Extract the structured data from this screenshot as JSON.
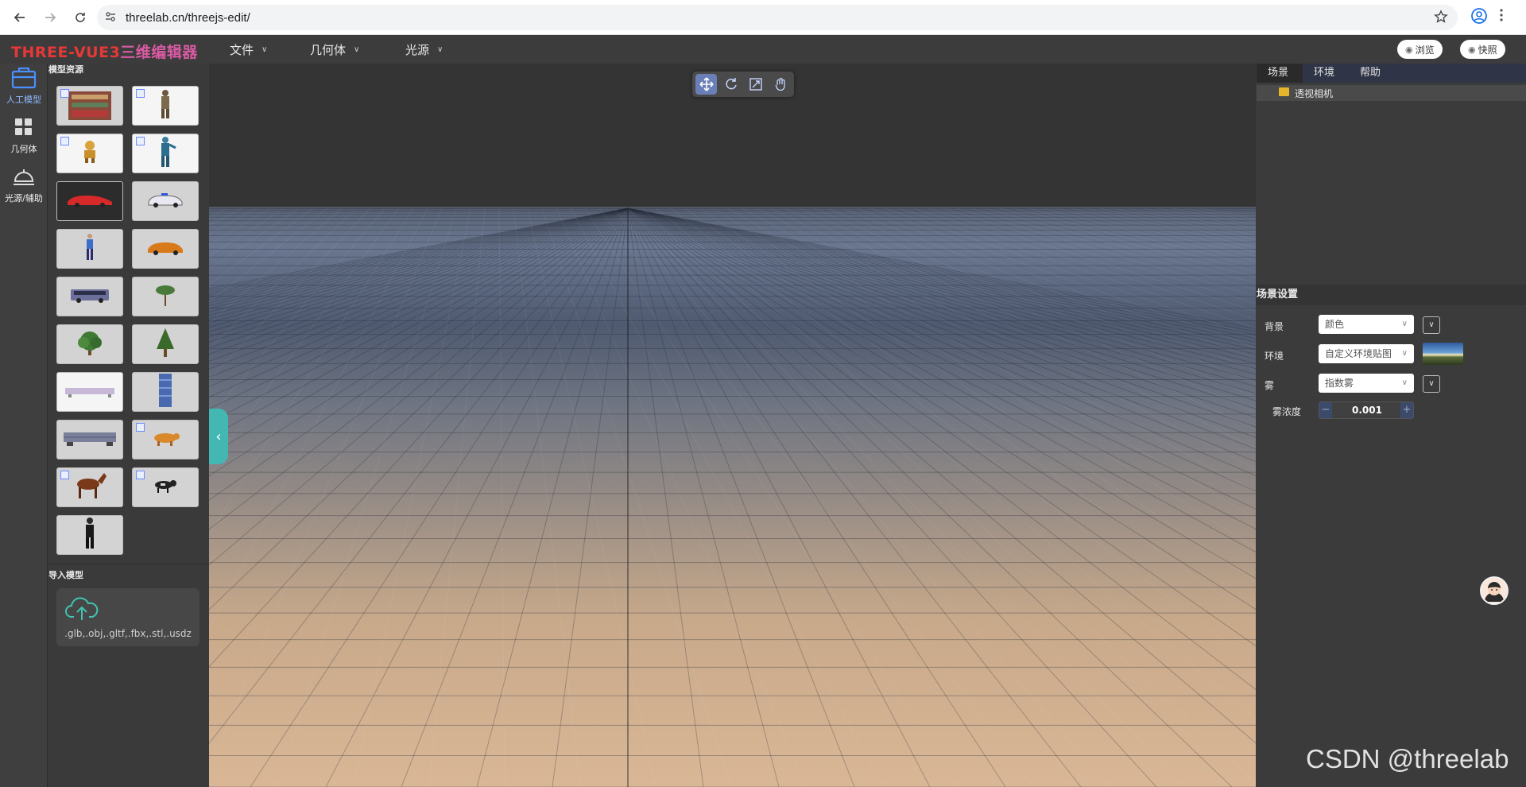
{
  "browser": {
    "url": "threelab.cn/threejs-edit/"
  },
  "app": {
    "title_latin": "THREE-VUE3",
    "title_cn": "三维编辑器",
    "menus": [
      {
        "label": "文件"
      },
      {
        "label": "几何体"
      },
      {
        "label": "光源"
      }
    ],
    "preview_label": "浏览",
    "snapshot_label": "快照"
  },
  "rail": [
    {
      "label": "人工模型",
      "icon": "box-icon",
      "active": true
    },
    {
      "label": "几何体",
      "icon": "grid-icon",
      "active": false
    },
    {
      "label": "光源/辅助",
      "icon": "lamp-icon",
      "active": false
    }
  ],
  "models_panel": {
    "title": "模型资源",
    "thumbnails": [
      {
        "name": "building",
        "tagged": true
      },
      {
        "name": "soldier",
        "tagged": true
      },
      {
        "name": "robot",
        "tagged": true
      },
      {
        "name": "blue-character",
        "tagged": true
      },
      {
        "name": "red-car",
        "tagged": false
      },
      {
        "name": "police-car",
        "tagged": false
      },
      {
        "name": "person",
        "tagged": false
      },
      {
        "name": "orange-car",
        "tagged": false
      },
      {
        "name": "bus",
        "tagged": false
      },
      {
        "name": "small-tree",
        "tagged": false
      },
      {
        "name": "bush-tree",
        "tagged": false
      },
      {
        "name": "tall-tree",
        "tagged": false
      },
      {
        "name": "platform",
        "tagged": false
      },
      {
        "name": "pillar",
        "tagged": false
      },
      {
        "name": "train",
        "tagged": false
      },
      {
        "name": "tiger",
        "tagged": true
      },
      {
        "name": "horse",
        "tagged": true
      },
      {
        "name": "cow",
        "tagged": true
      },
      {
        "name": "man-suit",
        "tagged": false
      }
    ],
    "import_title": "导入模型",
    "import_formats": ".glb,.obj,.gltf,.fbx,.stl,.usdz"
  },
  "toolbar": {
    "tools": [
      {
        "name": "move-tool",
        "active": true
      },
      {
        "name": "rotate-tool",
        "active": false
      },
      {
        "name": "scale-tool",
        "active": false
      },
      {
        "name": "pan-tool",
        "active": false
      }
    ]
  },
  "right_panel": {
    "tabs": [
      "场景",
      "环境",
      "帮助"
    ],
    "active_tab": "场景",
    "tree": [
      {
        "label": "透视相机"
      }
    ],
    "settings_title": "场景设置",
    "background_label": "背景",
    "background_value": "颜色",
    "environment_label": "环境",
    "environment_value": "自定义环境贴图",
    "fog_label": "雾",
    "fog_value": "指数雾",
    "fog_density_label": "雾浓度",
    "fog_density_value": "0.001"
  },
  "watermark": "CSDN @threelab"
}
